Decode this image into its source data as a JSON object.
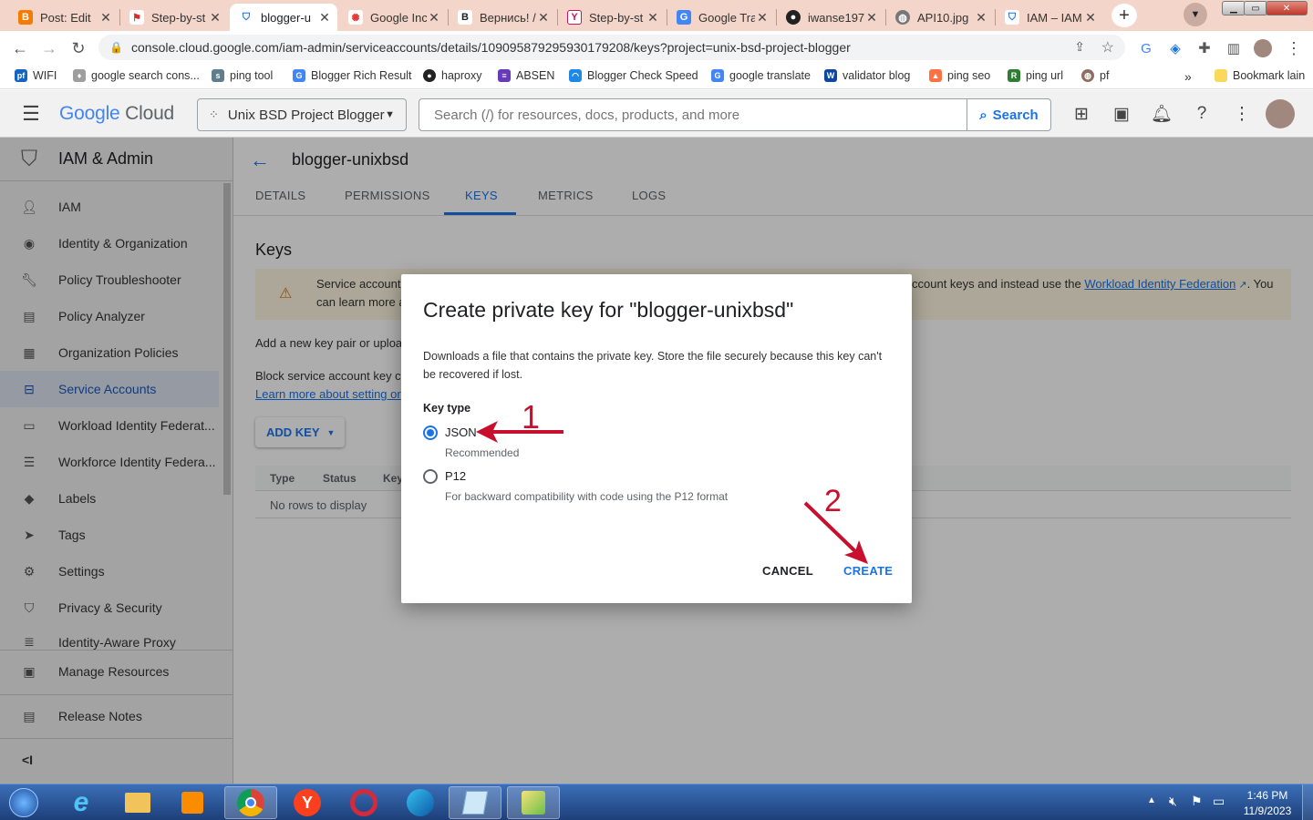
{
  "browser": {
    "tabs": [
      {
        "title": "Post: Edit",
        "icon": "blogger-icon",
        "color": "#f57c00"
      },
      {
        "title": "Step-by-st",
        "icon": "flag-icon",
        "color": "#d32f2f"
      },
      {
        "title": "blogger-u",
        "icon": "shield-icon",
        "color": "#1a73e8",
        "active": true
      },
      {
        "title": "Google Inc",
        "icon": "gear-icon",
        "color": "#e53935"
      },
      {
        "title": "Вернись! /",
        "icon": "b-letter-icon",
        "color": "#222222"
      },
      {
        "title": "Step-by-st",
        "icon": "page-icon",
        "color": "#c2185b"
      },
      {
        "title": "Google Tra",
        "icon": "translate-icon",
        "color": "#4285f4"
      },
      {
        "title": "iwanse197",
        "icon": "github-icon",
        "color": "#222222"
      },
      {
        "title": "API10.jpg",
        "icon": "globe-icon",
        "color": "#666666"
      },
      {
        "title": "IAM – IAM",
        "icon": "shield-icon",
        "color": "#1a73e8"
      }
    ],
    "url": "console.cloud.google.com/iam-admin/serviceaccounts/details/109095879295930179208/keys?project=unix-bsd-project-blogger",
    "bookmarks": [
      {
        "label": "WIFI",
        "color": "#1565c0"
      },
      {
        "label": "google search cons...",
        "color": "#9e9e9e"
      },
      {
        "label": "ping tool",
        "color": "#607d8b"
      },
      {
        "label": "Blogger Rich Result",
        "color": "#4285f4"
      },
      {
        "label": "haproxy",
        "color": "#222222"
      },
      {
        "label": "ABSEN",
        "color": "#673ab7"
      },
      {
        "label": "Blogger Check Speed",
        "color": "#1e88e5"
      },
      {
        "label": "google translate",
        "color": "#4285f4"
      },
      {
        "label": "validator blog",
        "color": "#0d47a1"
      },
      {
        "label": "ping seo",
        "color": "#ff7043"
      },
      {
        "label": "ping url",
        "color": "#2e7d32"
      },
      {
        "label": "pf",
        "color": "#8d6e63"
      }
    ],
    "bookmarks_more": "»",
    "bookmark_other": "Bookmark lain"
  },
  "gcp": {
    "logo_google": "Google",
    "logo_cloud": "Cloud",
    "project": "Unix BSD Project Blogger",
    "search_placeholder": "Search (/) for resources, docs, products, and more",
    "search_button": "Search"
  },
  "sidebar": {
    "title": "IAM & Admin",
    "items": [
      {
        "label": "IAM",
        "icon": "person-add-icon"
      },
      {
        "label": "Identity & Organization",
        "icon": "account-circle-icon"
      },
      {
        "label": "Policy Troubleshooter",
        "icon": "wrench-icon"
      },
      {
        "label": "Policy Analyzer",
        "icon": "document-search-icon"
      },
      {
        "label": "Organization Policies",
        "icon": "policy-list-icon"
      },
      {
        "label": "Service Accounts",
        "icon": "service-account-icon",
        "selected": true
      },
      {
        "label": "Workload Identity Federat...",
        "icon": "id-card-icon"
      },
      {
        "label": "Workforce Identity Federa...",
        "icon": "list-icon"
      },
      {
        "label": "Labels",
        "icon": "label-icon"
      },
      {
        "label": "Tags",
        "icon": "tag-icon"
      },
      {
        "label": "Settings",
        "icon": "gear-icon"
      },
      {
        "label": "Privacy & Security",
        "icon": "shield-icon"
      },
      {
        "label": "Identity-Aware Proxy",
        "icon": "proxy-icon"
      }
    ],
    "manage_resources": "Manage Resources",
    "release_notes": "Release Notes",
    "collapse": "<I"
  },
  "page": {
    "title": "blogger-unixbsd",
    "tabs": [
      "DETAILS",
      "PERMISSIONS",
      "KEYS",
      "METRICS",
      "LOGS"
    ],
    "section_title": "Keys",
    "warning_line1_left": "Service account",
    "warning_line1_right": "ccount keys and instead use the",
    "warning_link": "Workload Identity Federation",
    "warning_line1_end": ". You",
    "warning_line2": "can learn more a",
    "add_key_text": "Add a new key pair or uploa",
    "block_text": "Block service account key c",
    "learn_more": "Learn more about setting or",
    "add_key_button": "ADD KEY",
    "table_headers": [
      "Type",
      "Status",
      "Key"
    ],
    "empty_text": "No rows to display"
  },
  "dialog": {
    "title": "Create private key for \"blogger-unixbsd\"",
    "description": "Downloads a file that contains the private key. Store the file securely because this key can't be recovered if lost.",
    "key_type_label": "Key type",
    "options": [
      {
        "label": "JSON",
        "sublabel": "Recommended",
        "selected": true
      },
      {
        "label": "P12",
        "sublabel": "For backward compatibility with code using the P12 format",
        "selected": false
      }
    ],
    "cancel": "CANCEL",
    "create": "CREATE",
    "annotation_1": "1",
    "annotation_2": "2",
    "annotation_color": "#c8102e"
  },
  "taskbar": {
    "time": "1:46 PM",
    "date": "11/9/2023",
    "apps": [
      "start-icon",
      "internet-explorer-icon",
      "file-explorer-icon",
      "media-player-icon",
      "chrome-icon",
      "yandex-icon",
      "opera-icon",
      "edge-icon",
      "notepad-icon",
      "paint-icon"
    ]
  }
}
